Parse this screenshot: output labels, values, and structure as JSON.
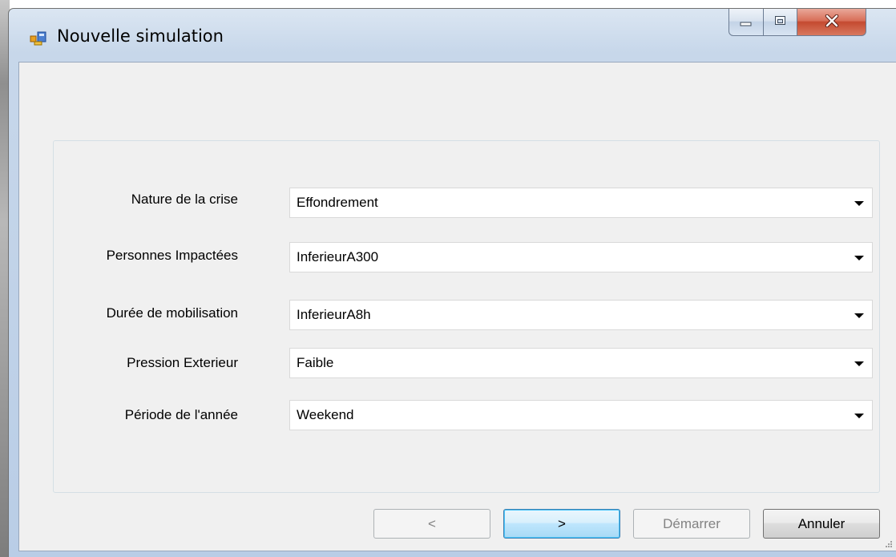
{
  "window": {
    "title": "Nouvelle simulation"
  },
  "form": {
    "fields": [
      {
        "label": "Nature de la crise",
        "value": "Effondrement"
      },
      {
        "label": "Personnes Impactées",
        "value": "InferieurA300"
      },
      {
        "label": "Durée de mobilisation",
        "value": "InferieurA8h"
      },
      {
        "label": "Pression Exterieur",
        "value": "Faible"
      },
      {
        "label": "Période de l'année",
        "value": "Weekend"
      }
    ]
  },
  "buttons": {
    "prev_label": "<",
    "next_label": ">",
    "start_label": "Démarrer",
    "cancel_label": "Annuler"
  },
  "colors": {
    "close_button": "#c44a30",
    "default_button_border": "#3c7fb1"
  }
}
